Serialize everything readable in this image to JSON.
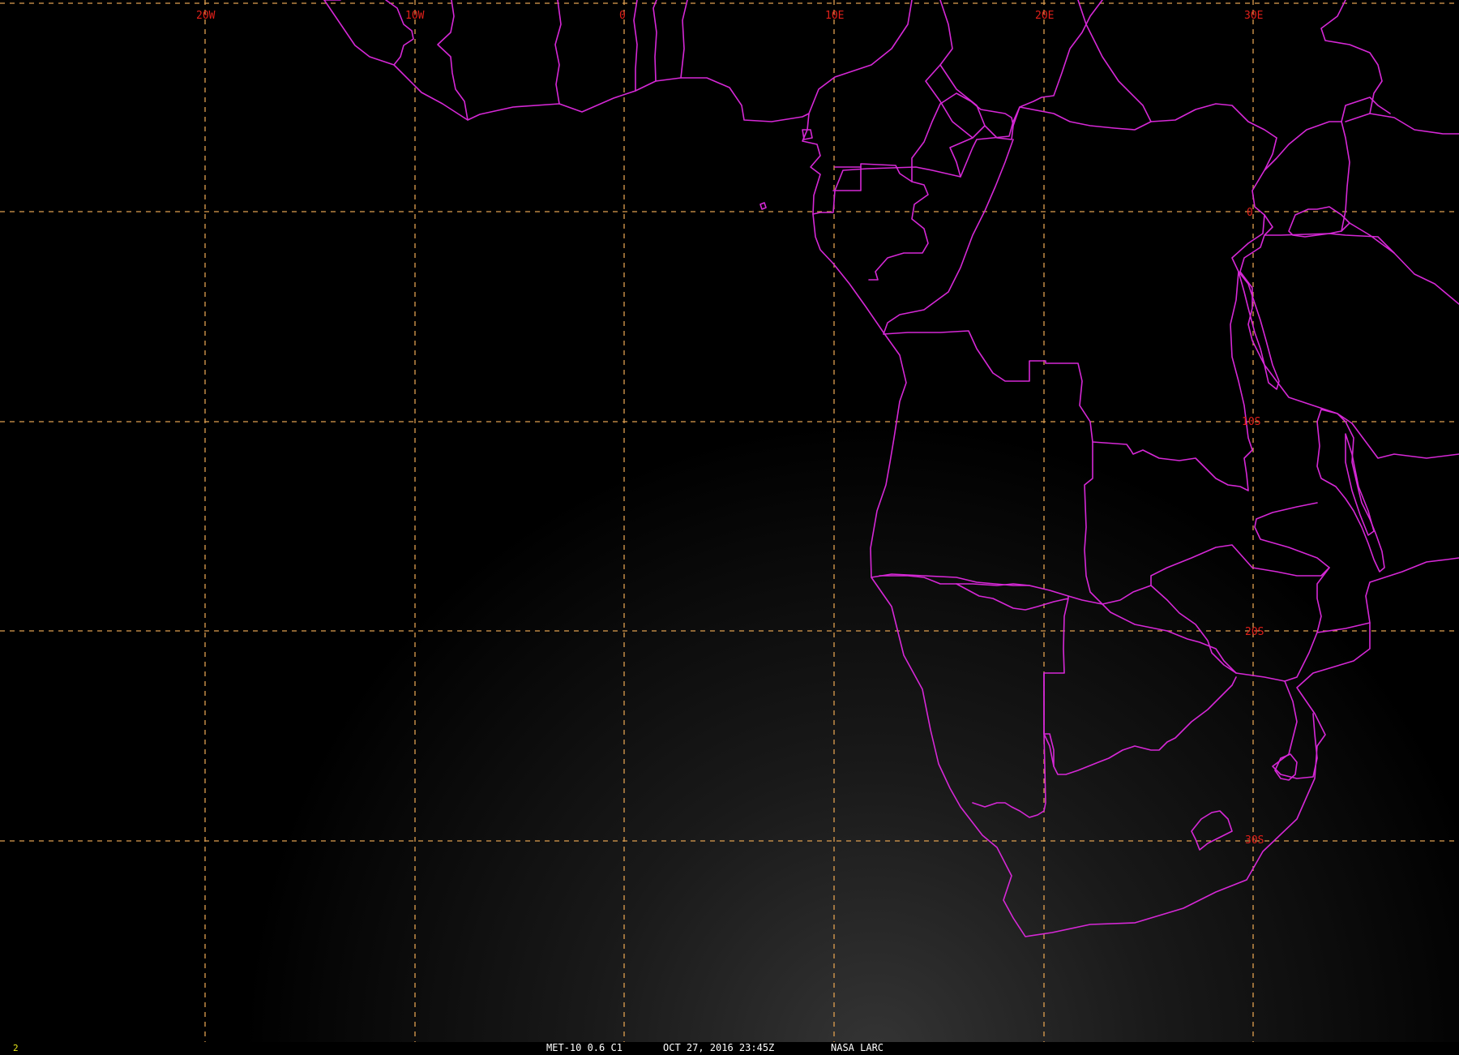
{
  "longitude_labels": [
    "20W",
    "10W",
    "0",
    "10E",
    "20E",
    "30E"
  ],
  "latitude_labels": [
    "0",
    "10S",
    "20S",
    "30S"
  ],
  "frame_number": "2",
  "status": {
    "satellite": "MET-10 0.6 C1",
    "datetime": "OCT 27, 2016 23:45Z",
    "source": "NASA LARC"
  },
  "colors": {
    "background": "#000000",
    "borders": "#d628d6",
    "grid": "#e0a050",
    "grid_labels": "#e0201a",
    "status_text": "#ffffff",
    "frame_number": "#e8e81a"
  }
}
